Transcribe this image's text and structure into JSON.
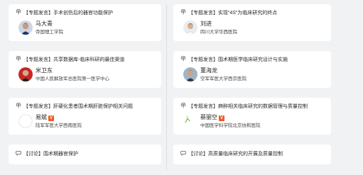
{
  "sessions": [
    {
      "title": "【专题发言】手术创伤后的器官功能保护",
      "speaker": "马大青",
      "org": "帝国理工学院",
      "verified": false
    },
    {
      "title": "【专题发言】实现“4S”为临床研究的终点",
      "speaker": "刘进",
      "org": "四川大学华西医院",
      "verified": false
    },
    {
      "title": "【专题发言】共享数据库-临床科研的最佳渠道",
      "speaker": "米卫东",
      "org": "中国人民解放军总医院第一医学中心",
      "verified": false
    },
    {
      "title": "【专题发言】围术期医学临床研究设计与实施",
      "speaker": "董海龙",
      "org": "空军军医大学西京医院",
      "verified": false
    },
    {
      "title": "【专题发言】肝硬化患者围术期肝脏保护相关问题",
      "speaker": "易斌",
      "org": "陆军军医大学西南医院",
      "verified": true
    },
    {
      "title": "【专题发言】麻醉相关临床研究的数据管理与质量控制",
      "speaker": "蔡丽空",
      "org": "中国医学科学院北京协和医院",
      "verified": true
    }
  ],
  "discussions": [
    {
      "title": "【讨论】围术期器官保护"
    },
    {
      "title": "【讨论】高质量临床研究的开展及质量控制"
    }
  ],
  "badge": {
    "verified_label": "V"
  },
  "colors": {
    "background": "#f1f2f4",
    "card": "#ffffff",
    "badge": "#f05a23",
    "icon": "#555555"
  },
  "icons": {
    "topic": "podcast-icon",
    "discussion": "chat-bubble-icon"
  }
}
